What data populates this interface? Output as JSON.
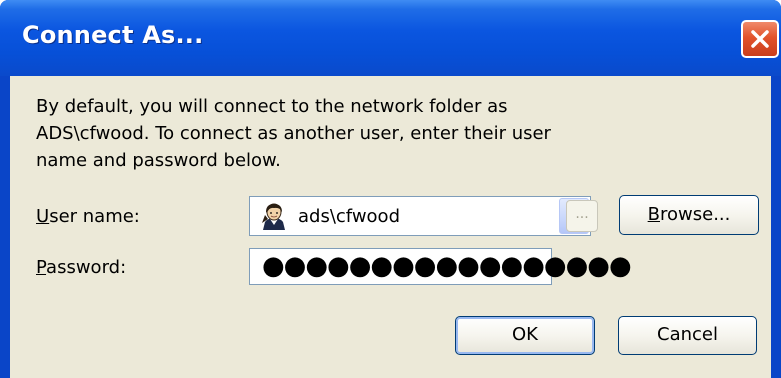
{
  "window": {
    "title": "Connect As..."
  },
  "message": {
    "line1": "By default, you will connect to the network folder as",
    "line2": "ADS\\cfwood. To connect as another user, enter their user",
    "line3": "name and password below."
  },
  "user_name": {
    "label_accel": "U",
    "label_rest": "ser name:",
    "value": "ads\\cfwood",
    "icon": "user-icon"
  },
  "password": {
    "label_accel": "P",
    "label_rest": "assword:",
    "masked_value": "●●●●●●●●●●●●●●●●●"
  },
  "buttons": {
    "ellipsis": "...",
    "browse_accel": "B",
    "browse_rest": "rowse...",
    "ok": "OK",
    "cancel": "Cancel"
  }
}
